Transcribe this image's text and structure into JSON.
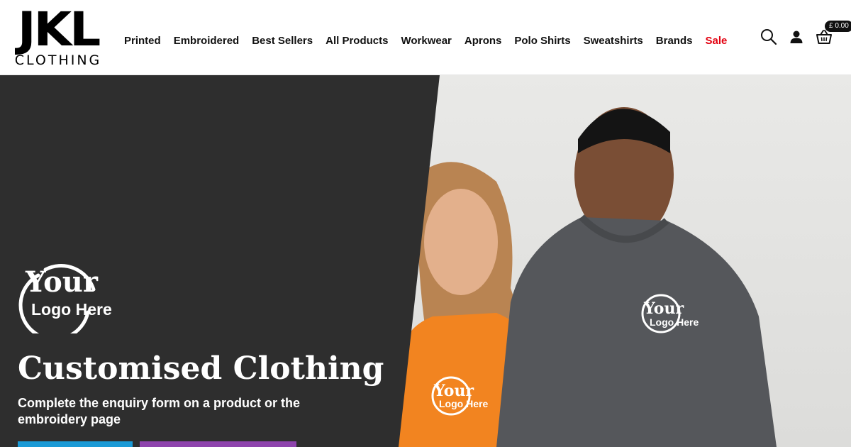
{
  "brand": {
    "name": "JKL",
    "sub": "CLOTHING"
  },
  "nav": [
    {
      "label": "Printed"
    },
    {
      "label": "Embroidered"
    },
    {
      "label": "Best Sellers"
    },
    {
      "label": "All Products"
    },
    {
      "label": "Workwear"
    },
    {
      "label": "Aprons"
    },
    {
      "label": "Polo Shirts"
    },
    {
      "label": "Sweatshirts"
    },
    {
      "label": "Brands"
    },
    {
      "label": "Sale"
    }
  ],
  "header_icons": {
    "search": "search-icon",
    "account": "user-icon",
    "cart": "basket-icon"
  },
  "cart": {
    "total": "£ 0.00"
  },
  "hero": {
    "logo_line1": "Your",
    "logo_line2": "Logo Here",
    "title": "Customised Clothing",
    "subtitle": "Complete the enquiry form on a product or the embroidery page"
  },
  "colors": {
    "sale": "#e3000f",
    "hero_dark": "#2e2e2e",
    "button_blue": "#1a9ad6",
    "button_purple": "#8e44ad"
  }
}
